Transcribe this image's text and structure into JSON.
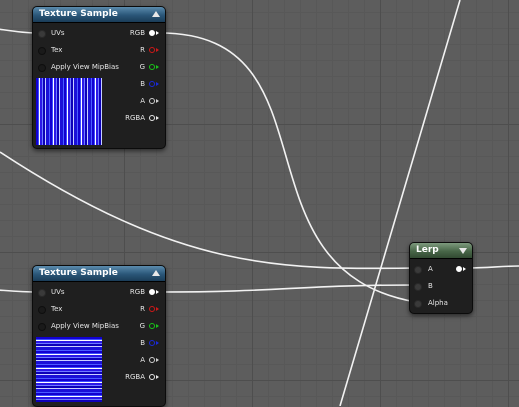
{
  "colors": {
    "canvas_bg": "#5d5d5d",
    "texture_header": "#2a5678",
    "lerp_header": "#486648",
    "node_body": "#1f1f1f",
    "wire": "#ffffff",
    "pin_r": "#d01818",
    "pin_g": "#19c419",
    "pin_b": "#1a2ad8",
    "texture_preview": "#1200d0"
  },
  "icons": {
    "collapse_up": "triangle-up",
    "collapse_down": "triangle-down",
    "input_pin": "circle",
    "output_pin": "circle-arrow"
  },
  "node_texture_1": {
    "title": "Texture Sample",
    "inputs": [
      "UVs",
      "Tex",
      "Apply View MipBias"
    ],
    "outputs": [
      "RGB",
      "R",
      "G",
      "B",
      "A",
      "RGBA"
    ]
  },
  "node_texture_2": {
    "title": "Texture Sample",
    "inputs": [
      "UVs",
      "Tex",
      "Apply View MipBias"
    ],
    "outputs": [
      "RGB",
      "R",
      "G",
      "B",
      "A",
      "RGBA"
    ]
  },
  "node_lerp": {
    "title": "Lerp",
    "inputs": [
      "A",
      "B",
      "Alpha"
    ]
  }
}
